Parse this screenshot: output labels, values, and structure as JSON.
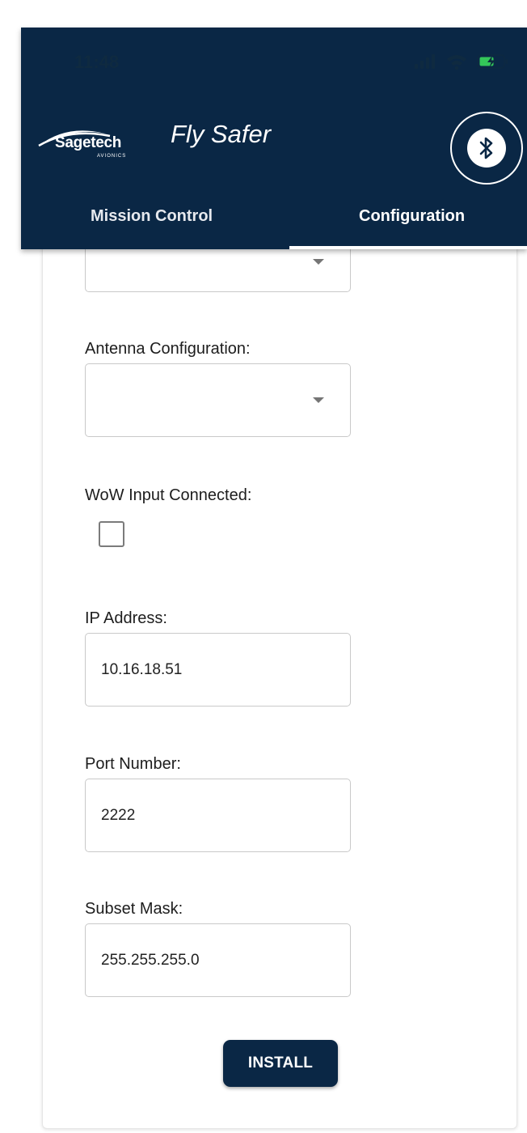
{
  "status_bar": {
    "time": "11:48"
  },
  "header": {
    "logo_text": "Sagetech",
    "logo_subtext": "AVIONICS",
    "title": "Fly Safer",
    "bluetooth_icon": "bluetooth-icon"
  },
  "tabs": [
    {
      "label": "Mission Control",
      "active": false
    },
    {
      "label": "Configuration",
      "active": true
    }
  ],
  "form": {
    "first_dropdown": {
      "value": ""
    },
    "antenna": {
      "label": "Antenna Configuration:",
      "value": ""
    },
    "wow": {
      "label": "WoW Input Connected:",
      "checked": false
    },
    "ip": {
      "label": "IP Address:",
      "value": "10.16.18.51"
    },
    "port": {
      "label": "Port Number:",
      "value": "2222"
    },
    "subset": {
      "label": "Subset Mask:",
      "value": "255.255.255.0"
    },
    "install_label": "INSTALL"
  },
  "colors": {
    "header_bg": "#0a2745",
    "button_bg": "#0a2745",
    "battery_fill": "#34c759"
  }
}
